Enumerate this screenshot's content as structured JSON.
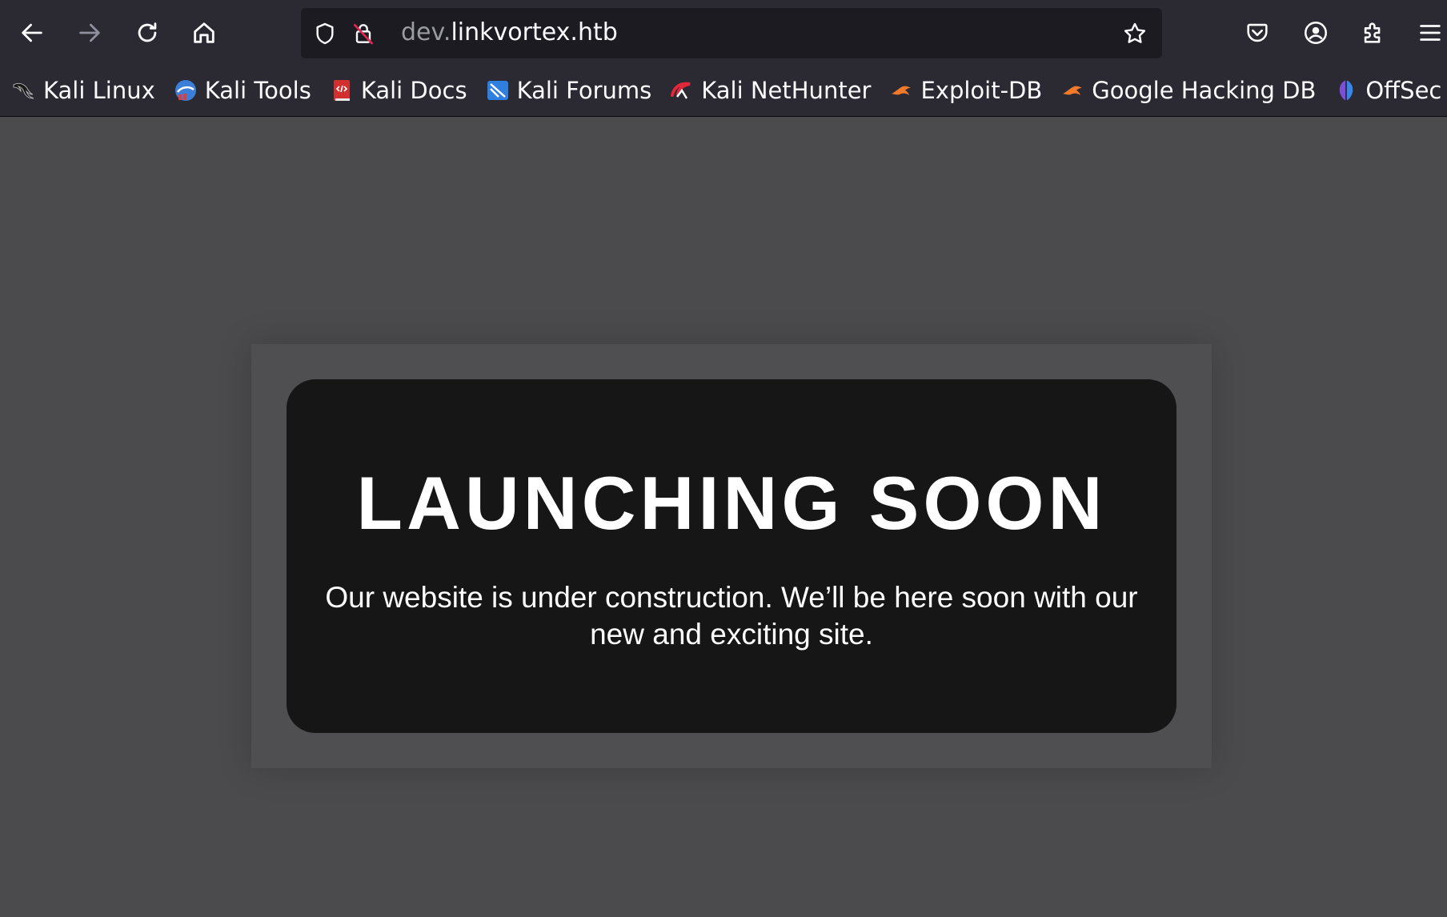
{
  "browser": {
    "url_prefix": "dev.",
    "url_domain": "linkvortex.htb",
    "bookmarks": [
      {
        "label": "Kali Linux",
        "icon": "kali-dragon-icon"
      },
      {
        "label": "Kali Tools",
        "icon": "kali-tools-icon"
      },
      {
        "label": "Kali Docs",
        "icon": "kali-docs-icon"
      },
      {
        "label": "Kali Forums",
        "icon": "kali-forums-icon"
      },
      {
        "label": "Kali NetHunter",
        "icon": "kali-nethunter-icon"
      },
      {
        "label": "Exploit-DB",
        "icon": "exploit-db-icon"
      },
      {
        "label": "Google Hacking DB",
        "icon": "ghdb-icon"
      },
      {
        "label": "OffSec",
        "icon": "offsec-icon"
      }
    ]
  },
  "page": {
    "headline": "LAUNCHING SOON",
    "message": "Our website is under construction. We’ll be here soon with our new and exciting site."
  },
  "colors": {
    "chrome": "#2b2a33",
    "urlbar": "#1c1b22",
    "page_bg": "#4b4b4d",
    "card_bg": "#161617"
  }
}
